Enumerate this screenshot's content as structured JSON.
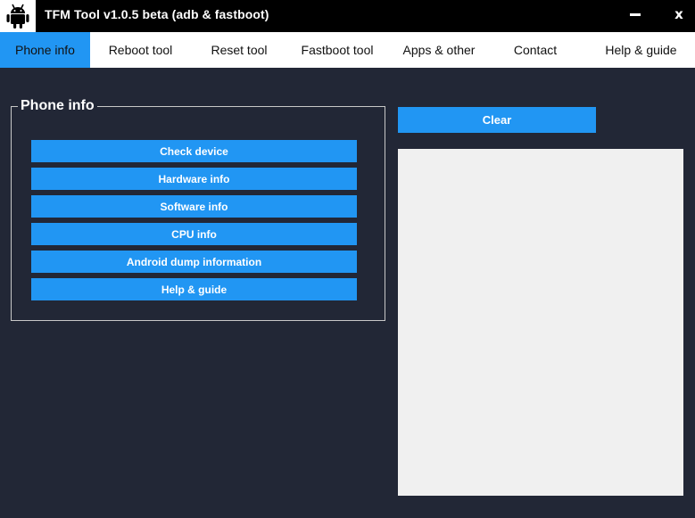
{
  "window": {
    "title": "TFM Tool v1.0.5 beta (adb & fastboot)",
    "icon": "android-robot-icon",
    "close_label": "x"
  },
  "tabs": [
    {
      "label": "Phone info",
      "active": true
    },
    {
      "label": "Reboot tool",
      "active": false
    },
    {
      "label": "Reset tool",
      "active": false
    },
    {
      "label": "Fastboot tool",
      "active": false
    },
    {
      "label": "Apps & other",
      "active": false
    },
    {
      "label": "Contact",
      "active": false
    },
    {
      "label": "Help & guide",
      "active": false
    }
  ],
  "phone_info": {
    "group_title": "Phone info",
    "buttons": [
      "Check device",
      "Hardware info",
      "Software info",
      "CPU info",
      "Android dump information",
      "Help & guide"
    ]
  },
  "output": {
    "clear_label": "Clear",
    "text": ""
  },
  "colors": {
    "accent": "#2196f3",
    "background": "#222736",
    "titlebar": "#000000",
    "tabbar": "#ffffff",
    "output_bg": "#f0f0f0"
  }
}
